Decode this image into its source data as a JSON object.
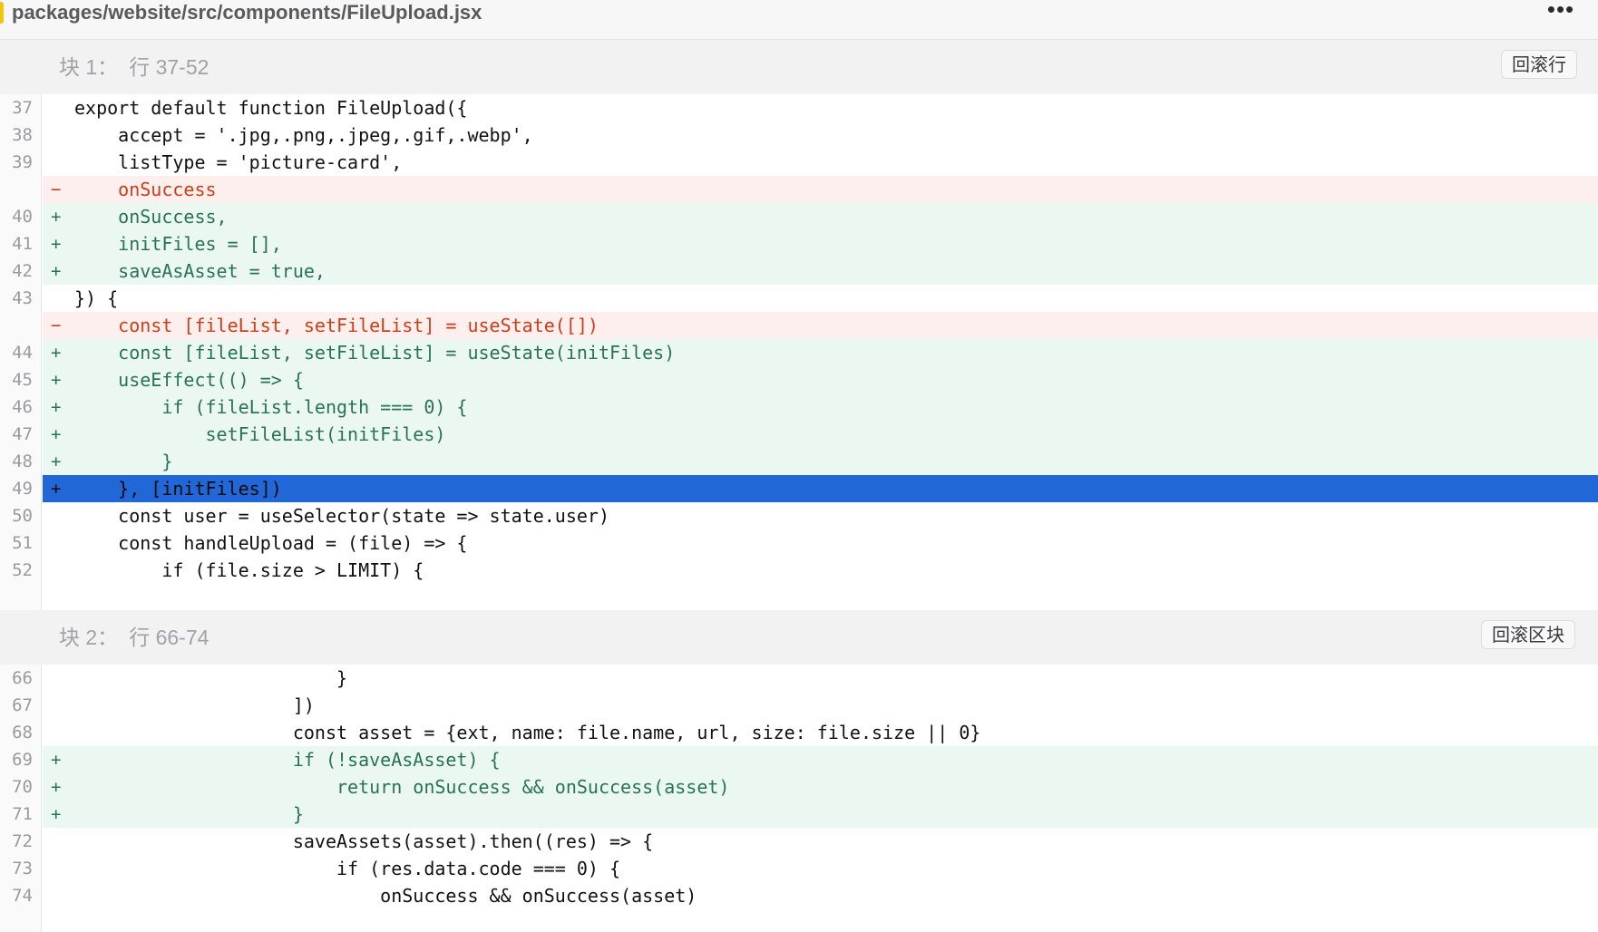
{
  "file": {
    "path": "packages/website/src/components/FileUpload.jsx",
    "more_label": "•••"
  },
  "colors": {
    "added_bg": "#ebf8f1",
    "added_text": "#287355",
    "removed_bg": "#fdefed",
    "removed_text": "#cc3d18",
    "selected_bg": "#2267d8"
  },
  "hunks": [
    {
      "label": "块 1：",
      "range": "行 37-52",
      "revert_label": "回滚行",
      "lines": [
        {
          "num": "37",
          "type": "context",
          "marker": "",
          "code": "export default function FileUpload({"
        },
        {
          "num": "38",
          "type": "context",
          "marker": "",
          "code": "    accept = '.jpg,.png,.jpeg,.gif,.webp',"
        },
        {
          "num": "39",
          "type": "context",
          "marker": "",
          "code": "    listType = 'picture-card',"
        },
        {
          "num": "",
          "type": "removed",
          "marker": "−",
          "code": "    onSuccess"
        },
        {
          "num": "40",
          "type": "added",
          "marker": "+",
          "code": "    onSuccess,"
        },
        {
          "num": "41",
          "type": "added",
          "marker": "+",
          "code": "    initFiles = [],"
        },
        {
          "num": "42",
          "type": "added",
          "marker": "+",
          "code": "    saveAsAsset = true,"
        },
        {
          "num": "43",
          "type": "context",
          "marker": "",
          "code": "}) {"
        },
        {
          "num": "",
          "type": "removed",
          "marker": "−",
          "code": "    const [fileList, setFileList] = useState([])"
        },
        {
          "num": "44",
          "type": "added",
          "marker": "+",
          "code": "    const [fileList, setFileList] = useState(initFiles)"
        },
        {
          "num": "45",
          "type": "added",
          "marker": "+",
          "code": "    useEffect(() => {"
        },
        {
          "num": "46",
          "type": "added",
          "marker": "+",
          "code": "        if (fileList.length === 0) {"
        },
        {
          "num": "47",
          "type": "added",
          "marker": "+",
          "code": "            setFileList(initFiles)"
        },
        {
          "num": "48",
          "type": "added",
          "marker": "+",
          "code": "        }"
        },
        {
          "num": "49",
          "type": "selected",
          "marker": "+",
          "code": "    }, [initFiles])"
        },
        {
          "num": "50",
          "type": "context",
          "marker": "",
          "code": "    const user = useSelector(state => state.user)"
        },
        {
          "num": "51",
          "type": "context",
          "marker": "",
          "code": "    const handleUpload = (file) => {"
        },
        {
          "num": "52",
          "type": "context",
          "marker": "",
          "code": "        if (file.size > LIMIT) {"
        }
      ]
    },
    {
      "label": "块 2：",
      "range": "行 66-74",
      "revert_label": "回滚区块",
      "lines": [
        {
          "num": "66",
          "type": "context",
          "marker": "",
          "code": "                        }"
        },
        {
          "num": "67",
          "type": "context",
          "marker": "",
          "code": "                    ])"
        },
        {
          "num": "68",
          "type": "context",
          "marker": "",
          "code": "                    const asset = {ext, name: file.name, url, size: file.size || 0}"
        },
        {
          "num": "69",
          "type": "added",
          "marker": "+",
          "code": "                    if (!saveAsAsset) {"
        },
        {
          "num": "70",
          "type": "added",
          "marker": "+",
          "code": "                        return onSuccess && onSuccess(asset)"
        },
        {
          "num": "71",
          "type": "added",
          "marker": "+",
          "code": "                    }"
        },
        {
          "num": "72",
          "type": "context",
          "marker": "",
          "code": "                    saveAssets(asset).then((res) => {"
        },
        {
          "num": "73",
          "type": "context",
          "marker": "",
          "code": "                        if (res.data.code === 0) {"
        },
        {
          "num": "74",
          "type": "context",
          "marker": "",
          "code": "                            onSuccess && onSuccess(asset)"
        }
      ]
    }
  ]
}
